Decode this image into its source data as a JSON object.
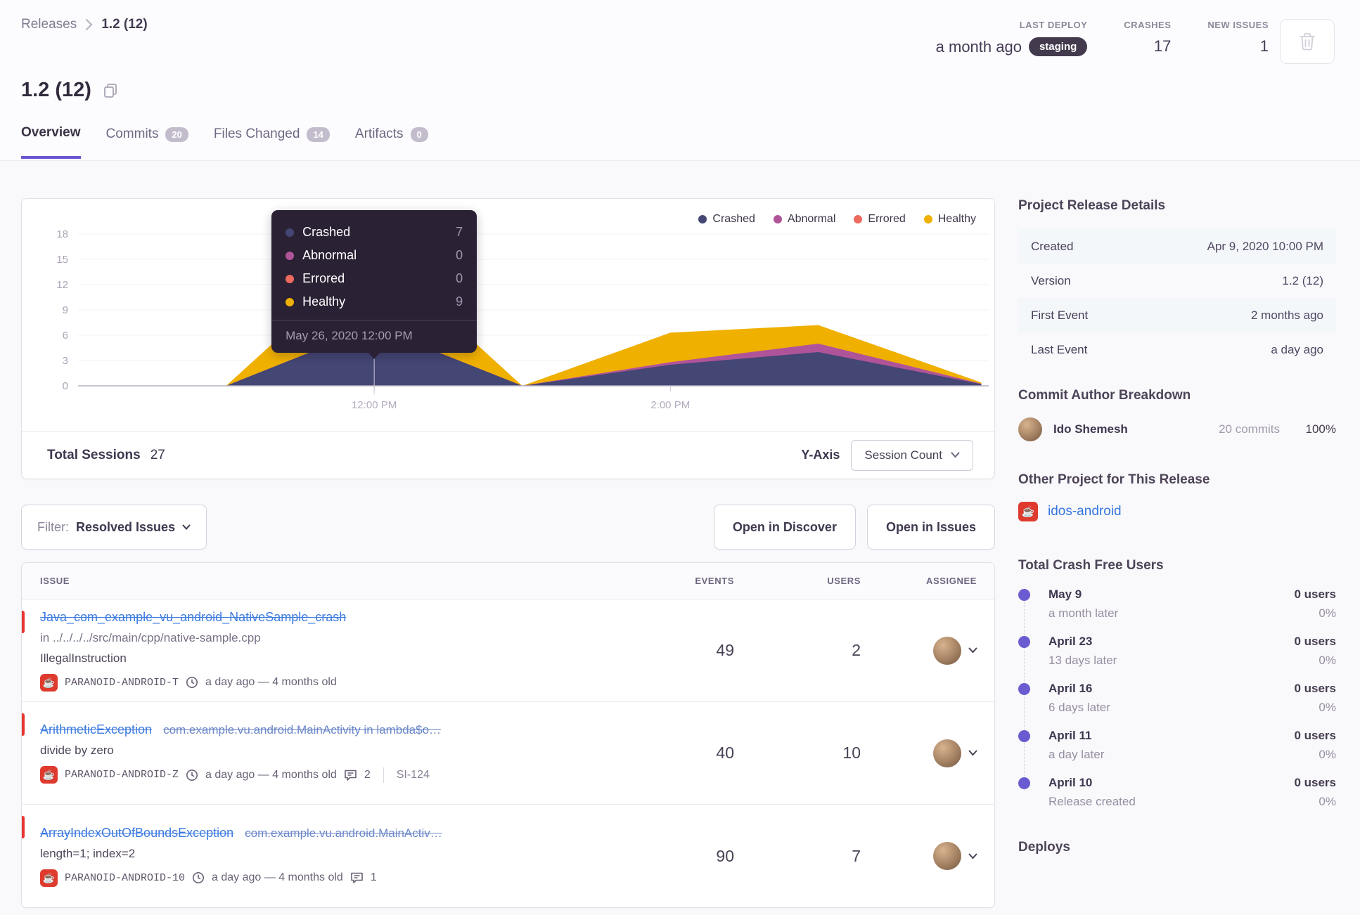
{
  "breadcrumb": {
    "parent": "Releases",
    "current": "1.2 (12)"
  },
  "header": {
    "title": "1.2 (12)",
    "stats": [
      {
        "label": "LAST DEPLOY",
        "value": "a month ago",
        "badge": "staging"
      },
      {
        "label": "CRASHES",
        "value": "17"
      },
      {
        "label": "NEW ISSUES",
        "value": "1"
      }
    ]
  },
  "tabs": {
    "overview": "Overview",
    "commits": "Commits",
    "commits_count": "20",
    "files": "Files Changed",
    "files_count": "14",
    "artifacts": "Artifacts",
    "artifacts_count": "0"
  },
  "icons": {
    "platform_glyph": "☕"
  },
  "chart_card": {
    "total_sessions_label": "Total Sessions",
    "total_sessions_value": "27",
    "y_axis_label": "Y-Axis",
    "y_axis_value": "Session Count"
  },
  "chart_data": {
    "type": "area",
    "stacked": true,
    "title": "Release sessions over time",
    "unit": "Session Count",
    "hour_domain": [
      10.0,
      16.15
    ],
    "hours": [
      10.0,
      11,
      12,
      13,
      14,
      15,
      16.1
    ],
    "series": [
      {
        "name": "Crashed",
        "color": "#444674",
        "values": [
          0,
          0,
          7,
          0,
          2.5,
          4,
          0.2
        ]
      },
      {
        "name": "Abnormal",
        "color": "#b05499",
        "values": [
          0,
          0,
          0,
          0,
          0.3,
          1,
          0.05
        ]
      },
      {
        "name": "Errored",
        "color": "#ec6a5e",
        "values": [
          0,
          0,
          0,
          0,
          0,
          0,
          0
        ]
      },
      {
        "name": "Healthy",
        "color": "#f0b000",
        "values": [
          0,
          0,
          9,
          0,
          3.5,
          2.2,
          0.15
        ]
      }
    ],
    "y_ticks": [
      0,
      3,
      6,
      9,
      12,
      15,
      18
    ],
    "y_max": 18,
    "x_ticks": [
      {
        "label": "12:00 PM",
        "hour": 12
      },
      {
        "label": "2:00 PM",
        "hour": 14
      }
    ],
    "legend_position": "top-right",
    "grid": true,
    "tooltip": {
      "anchor_hour": 12,
      "rows": [
        {
          "name": "Crashed",
          "value": "7"
        },
        {
          "name": "Abnormal",
          "value": "0"
        },
        {
          "name": "Errored",
          "value": "0"
        },
        {
          "name": "Healthy",
          "value": "9"
        }
      ],
      "footer": "May 26, 2020 12:00 PM"
    }
  },
  "filter_bar": {
    "label": "Filter:",
    "value": "Resolved Issues",
    "open_discover": "Open in Discover",
    "open_issues": "Open in Issues"
  },
  "issues_table": {
    "columns": [
      "ISSUE",
      "EVENTS",
      "USERS",
      "ASSIGNEE"
    ],
    "rows": [
      {
        "title": "Java_com_example_vu_android_NativeSample_crash",
        "location": "in ../../../../src/main/cpp/native-sample.cpp",
        "message": "IllegalInstruction",
        "project": "PARANOID-ANDROID-T",
        "age": "a day ago — 4 months old",
        "events": "49",
        "users": "2"
      },
      {
        "title": "ArithmeticException",
        "culprit": "com.example.vu.android.MainActivity in lambda$o…",
        "message": "divide by zero",
        "project": "PARANOID-ANDROID-Z",
        "age": "a day ago — 4 months old",
        "comments": "2",
        "short_id": "SI-124",
        "events": "40",
        "users": "10"
      },
      {
        "title": "ArrayIndexOutOfBoundsException",
        "culprit": "com.example.vu.android.MainActiv…",
        "message": "length=1; index=2",
        "project": "PARANOID-ANDROID-10",
        "age": "a day ago — 4 months old",
        "comments": "1",
        "events": "90",
        "users": "7"
      }
    ]
  },
  "sidebar": {
    "details": {
      "title": "Project Release Details",
      "rows": [
        {
          "label": "Created",
          "value": "Apr 9, 2020 10:00 PM"
        },
        {
          "label": "Version",
          "value": "1.2 (12)"
        },
        {
          "label": "First Event",
          "value": "2 months ago"
        },
        {
          "label": "Last Event",
          "value": "a day ago"
        }
      ]
    },
    "authors": {
      "title": "Commit Author Breakdown",
      "name": "Ido Shemesh",
      "commits": "20 commits",
      "percent": "100%"
    },
    "other_project": {
      "title": "Other Project for This Release",
      "link": "idos-android"
    },
    "crash_free": {
      "title": "Total Crash Free Users",
      "entries": [
        {
          "date": "May 9",
          "sub": "a month later",
          "users": "0 users",
          "pct": "0%"
        },
        {
          "date": "April 23",
          "sub": "13 days later",
          "users": "0 users",
          "pct": "0%"
        },
        {
          "date": "April 16",
          "sub": "6 days later",
          "users": "0 users",
          "pct": "0%"
        },
        {
          "date": "April 11",
          "sub": "a day later",
          "users": "0 users",
          "pct": "0%"
        },
        {
          "date": "April 10",
          "sub": "Release created",
          "users": "0 users",
          "pct": "0%"
        }
      ]
    },
    "deploys_title": "Deploys"
  }
}
